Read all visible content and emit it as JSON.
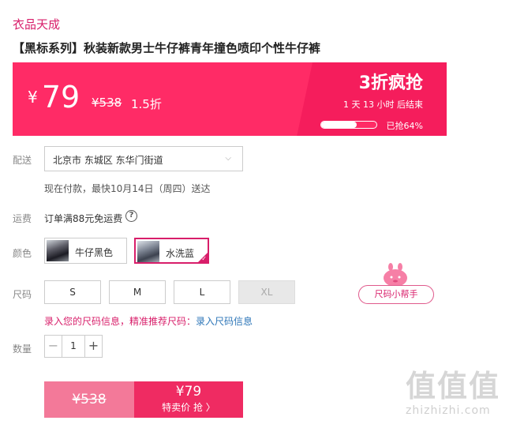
{
  "store": {
    "name": "衣品天成"
  },
  "product": {
    "title": "【黑标系列】秋装新款男士牛仔裤青年撞色喷印个性牛仔裤"
  },
  "banner": {
    "currency": "¥",
    "price": "79",
    "original_price": "¥538",
    "discount_rate": "1.5折",
    "promo_title": "3折疯抢",
    "countdown": "1 天 13 小时 后结束",
    "sold_label": "已抢64%",
    "sold_fraction": 0.64,
    "colors": {
      "main": "#ff2b66",
      "accent": "#d81e6a"
    }
  },
  "delivery": {
    "label": "配送",
    "address": "北京市 东城区 东华门街道",
    "note": "现在付款，最快10月14日（周四）送达",
    "chevron_icon": "chevron-down-icon"
  },
  "shipping": {
    "label": "运费",
    "text": "订单满88元免运费",
    "help_symbol": "?"
  },
  "color": {
    "label": "颜色",
    "options": [
      {
        "name": "牛仔黑色",
        "selected": false
      },
      {
        "name": "水洗蓝",
        "selected": true
      }
    ],
    "check_symbol": "✓"
  },
  "size": {
    "label": "尺码",
    "options": [
      {
        "name": "S",
        "available": true
      },
      {
        "name": "M",
        "available": true
      },
      {
        "name": "L",
        "available": true
      },
      {
        "name": "XL",
        "available": false
      }
    ],
    "helper_label": "尺码小帮手",
    "tip_text": "录入您的尺码信息，精准推荐尺码：",
    "tip_link": "录入尺码信息"
  },
  "quantity": {
    "label": "数量",
    "value": "1",
    "minus": "−",
    "plus": "+"
  },
  "buy": {
    "original_price": "¥538",
    "price": "¥79",
    "cta": "特卖价 抢 〉"
  },
  "watermark": {
    "glyphs": "值值值",
    "domain": "zhizhizhi.com"
  }
}
